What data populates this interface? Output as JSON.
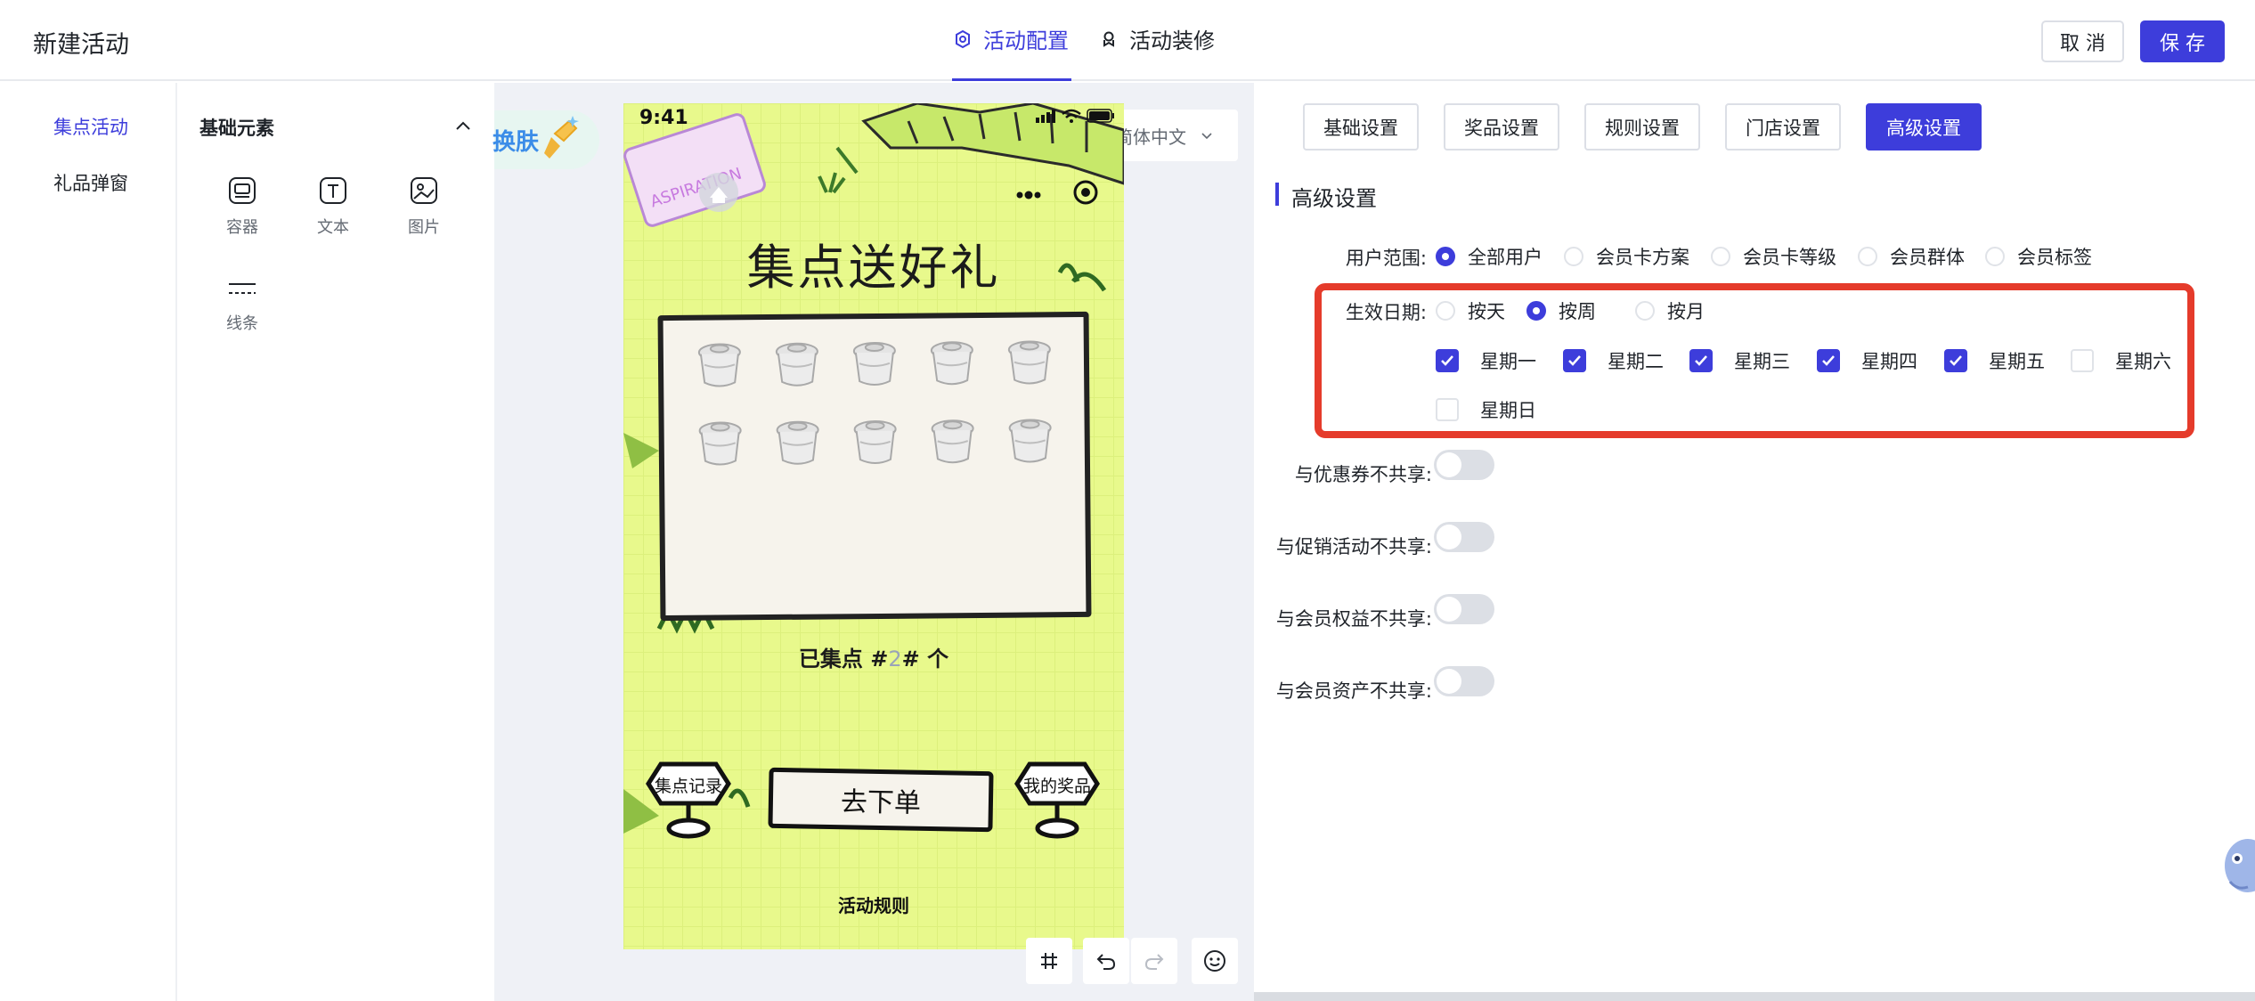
{
  "header": {
    "title": "新建活动",
    "tabs": [
      {
        "label": "活动配置",
        "icon": "settings-icon",
        "active": true
      },
      {
        "label": "活动装修",
        "icon": "decorate-icon",
        "active": false
      }
    ],
    "cancel_label": "取 消",
    "save_label": "保 存",
    "accent_color": "#3d3ddb"
  },
  "left_nav": {
    "items": [
      {
        "label": "集点活动",
        "active": true
      },
      {
        "label": "礼品弹窗",
        "active": false
      }
    ]
  },
  "elements": {
    "title": "基础元素",
    "items": [
      {
        "label": "容器",
        "icon": "container-icon"
      },
      {
        "label": "文本",
        "icon": "text-icon"
      },
      {
        "label": "图片",
        "icon": "image-icon"
      },
      {
        "label": "线条",
        "icon": "line-icon"
      }
    ]
  },
  "canvas": {
    "skin_label": "换肤",
    "language": "简体中文",
    "phone": {
      "time": "9:41",
      "title": "集点送好礼",
      "progress_prefix": "已集点 #",
      "progress_value": "2",
      "progress_suffix": "# 个",
      "record_label": "集点记录",
      "order_label": "去下单",
      "prize_label": "我的奖品",
      "rules_label": "活动规则",
      "stamp_count": 10,
      "background_color": "#e8f98c"
    },
    "tools": [
      "grid-icon",
      "undo-icon",
      "redo-icon",
      "emoji-icon"
    ]
  },
  "settings": {
    "tabs": [
      "基础设置",
      "奖品设置",
      "规则设置",
      "门店设置",
      "高级设置"
    ],
    "active_tab": "高级设置",
    "section_title": "高级设置",
    "user_scope": {
      "label": "用户范围:",
      "options": [
        "全部用户",
        "会员卡方案",
        "会员卡等级",
        "会员群体",
        "会员标签"
      ],
      "selected": "全部用户"
    },
    "effective_date": {
      "label": "生效日期:",
      "options": [
        "按天",
        "按周",
        "按月"
      ],
      "selected": "按周",
      "weekdays": [
        {
          "label": "星期一",
          "checked": true
        },
        {
          "label": "星期二",
          "checked": true
        },
        {
          "label": "星期三",
          "checked": true
        },
        {
          "label": "星期四",
          "checked": true
        },
        {
          "label": "星期五",
          "checked": true
        },
        {
          "label": "星期六",
          "checked": false
        },
        {
          "label": "星期日",
          "checked": false
        }
      ]
    },
    "toggles": [
      {
        "label": "与优惠券不共享:",
        "on": false
      },
      {
        "label": "与促销活动不共享:",
        "on": false
      },
      {
        "label": "与会员权益不共享:",
        "on": false
      },
      {
        "label": "与会员资产不共享:",
        "on": false
      }
    ],
    "highlight_color": "#e53b2b"
  }
}
